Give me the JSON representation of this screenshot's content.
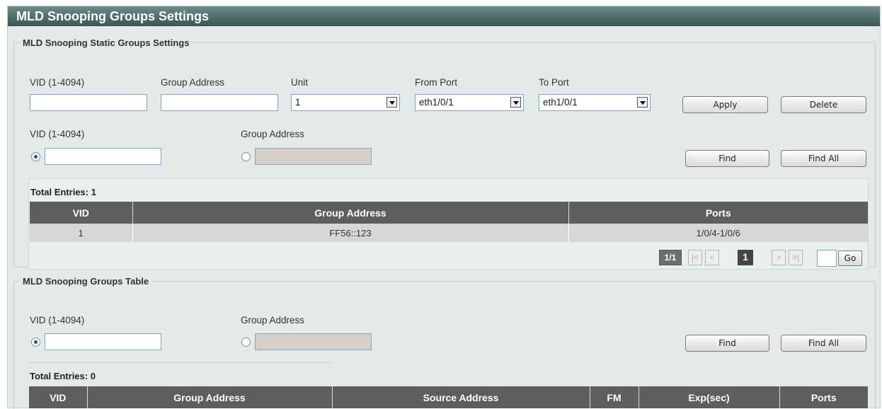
{
  "page": {
    "title": "MLD Snooping Groups Settings"
  },
  "static_groups": {
    "legend": "MLD Snooping Static Groups Settings",
    "vid_label": "VID (1-4094)",
    "vid_value": "",
    "group_address_label": "Group Address",
    "group_address_value": "",
    "unit_label": "Unit",
    "unit_value": "1",
    "from_port_label": "From Port",
    "from_port_value": "eth1/0/1",
    "to_port_label": "To Port",
    "to_port_value": "eth1/0/1",
    "apply_label": "Apply",
    "delete_label": "Delete",
    "find": {
      "vid_label": "VID (1-4094)",
      "vid_value": "",
      "vid_selected": true,
      "group_address_label": "Group Address",
      "group_address_value": "",
      "find_label": "Find",
      "find_all_label": "Find All"
    },
    "total_entries": "Total Entries: 1",
    "table": {
      "columns": [
        "VID",
        "Group Address",
        "Ports"
      ],
      "rows": [
        [
          "1",
          "FF56::123",
          "1/0/4-1/0/6"
        ]
      ]
    },
    "pagination": {
      "page_count": "1/1",
      "first": "|<",
      "prev": "<",
      "current": "1",
      "next": ">",
      "last": ">|",
      "go_label": "Go",
      "go_value": ""
    }
  },
  "groups_table": {
    "legend": "MLD Snooping Groups Table",
    "vid_label": "VID (1-4094)",
    "vid_value": "",
    "vid_selected": true,
    "group_address_label": "Group Address",
    "group_address_value": "",
    "find_label": "Find",
    "find_all_label": "Find All",
    "total_entries": "Total Entries: 0",
    "table": {
      "columns": [
        "VID",
        "Group Address",
        "Source Address",
        "FM",
        "Exp(sec)",
        "Ports"
      ],
      "rows": []
    }
  }
}
